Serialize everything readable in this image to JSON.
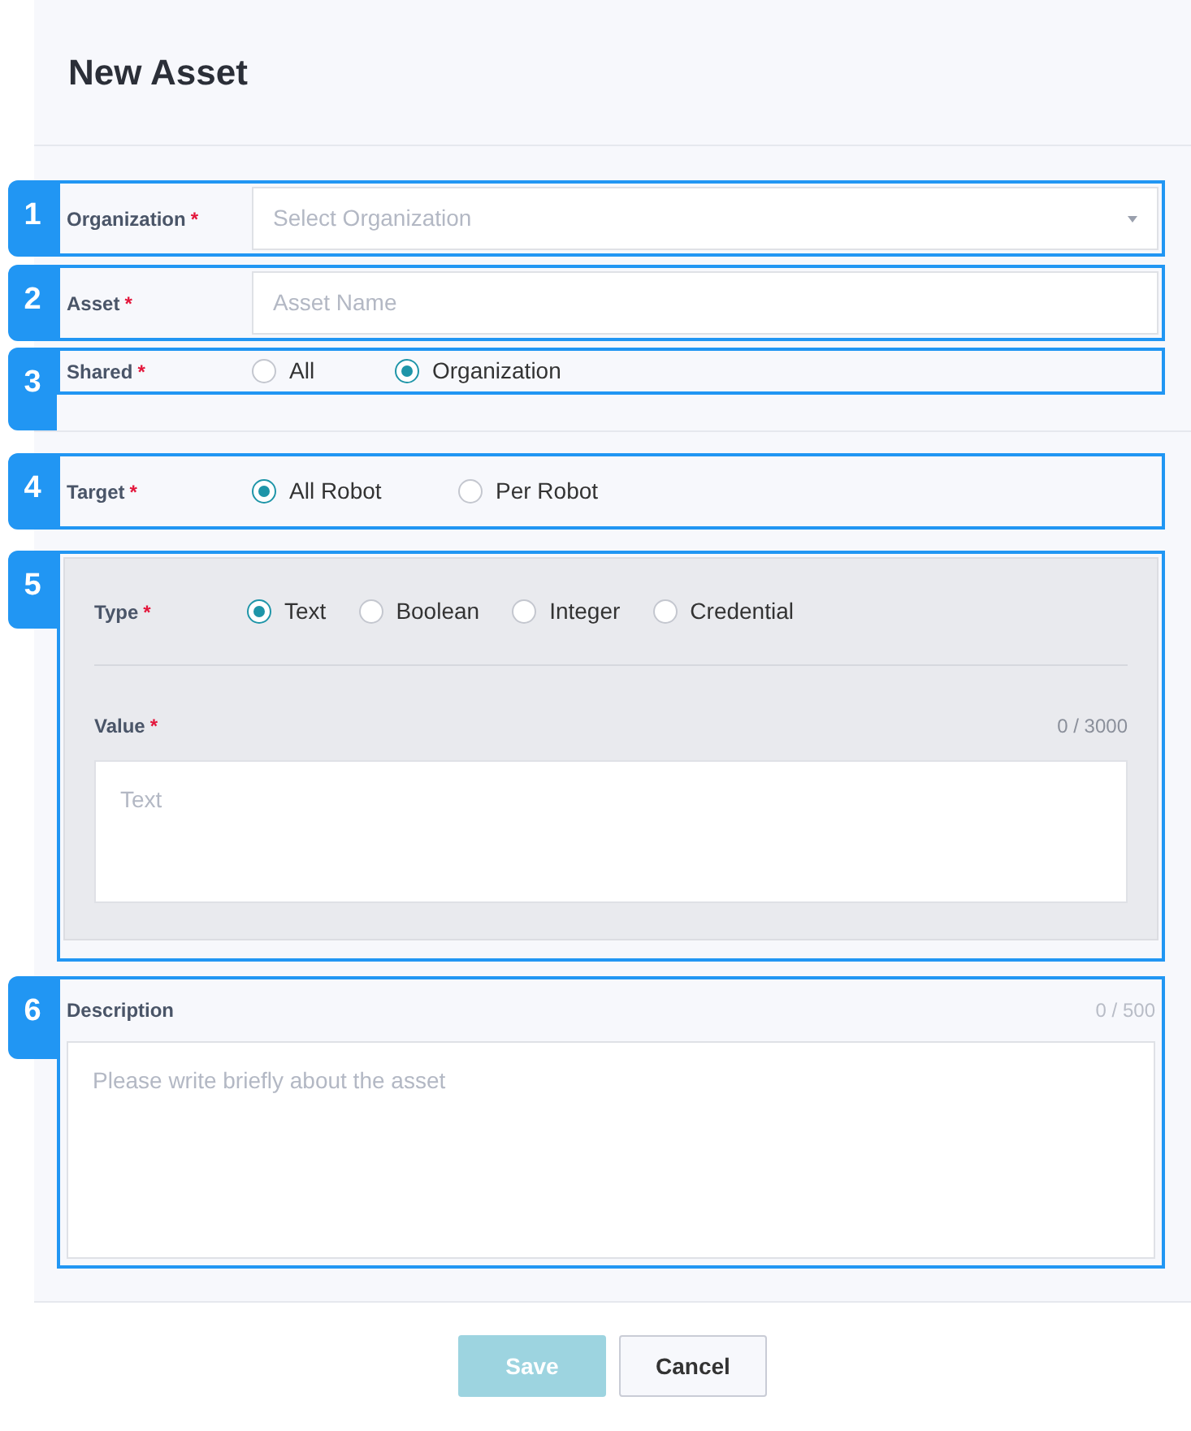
{
  "title": "New Asset",
  "sections": [
    {
      "marker": "1",
      "kind": "select",
      "label": "Organization",
      "required_mark": "*",
      "placeholder": "Select Organization"
    },
    {
      "marker": "2",
      "kind": "input",
      "label": "Asset",
      "required_mark": "*",
      "placeholder": "Asset Name"
    },
    {
      "marker": "3",
      "kind": "radio",
      "label": "Shared",
      "required_mark": "*",
      "options": [
        {
          "label": "All",
          "selected": false
        },
        {
          "label": "Organization",
          "selected": true
        }
      ]
    },
    {
      "marker": "4",
      "kind": "radio",
      "label": "Target",
      "required_mark": "*",
      "options": [
        {
          "label": "All Robot",
          "selected": true
        },
        {
          "label": "Per Robot",
          "selected": false
        }
      ]
    },
    {
      "marker": "5",
      "kind": "type",
      "label": "Type",
      "required_mark": "*",
      "options": [
        {
          "label": "Text",
          "selected": true
        },
        {
          "label": "Boolean",
          "selected": false
        },
        {
          "label": "Integer",
          "selected": false
        },
        {
          "label": "Credential",
          "selected": false
        }
      ],
      "value_label": "Value",
      "value_required_mark": "*",
      "counter": "0 / 3000",
      "placeholder": "Text"
    },
    {
      "marker": "6",
      "kind": "textarea",
      "label": "Description",
      "counter": "0 / 500",
      "placeholder": "Please write briefly about the asset"
    }
  ],
  "buttons": [
    {
      "label": "Save",
      "kind": "primary",
      "disabled": true
    },
    {
      "label": "Cancel",
      "kind": "secondary",
      "disabled": false
    }
  ]
}
